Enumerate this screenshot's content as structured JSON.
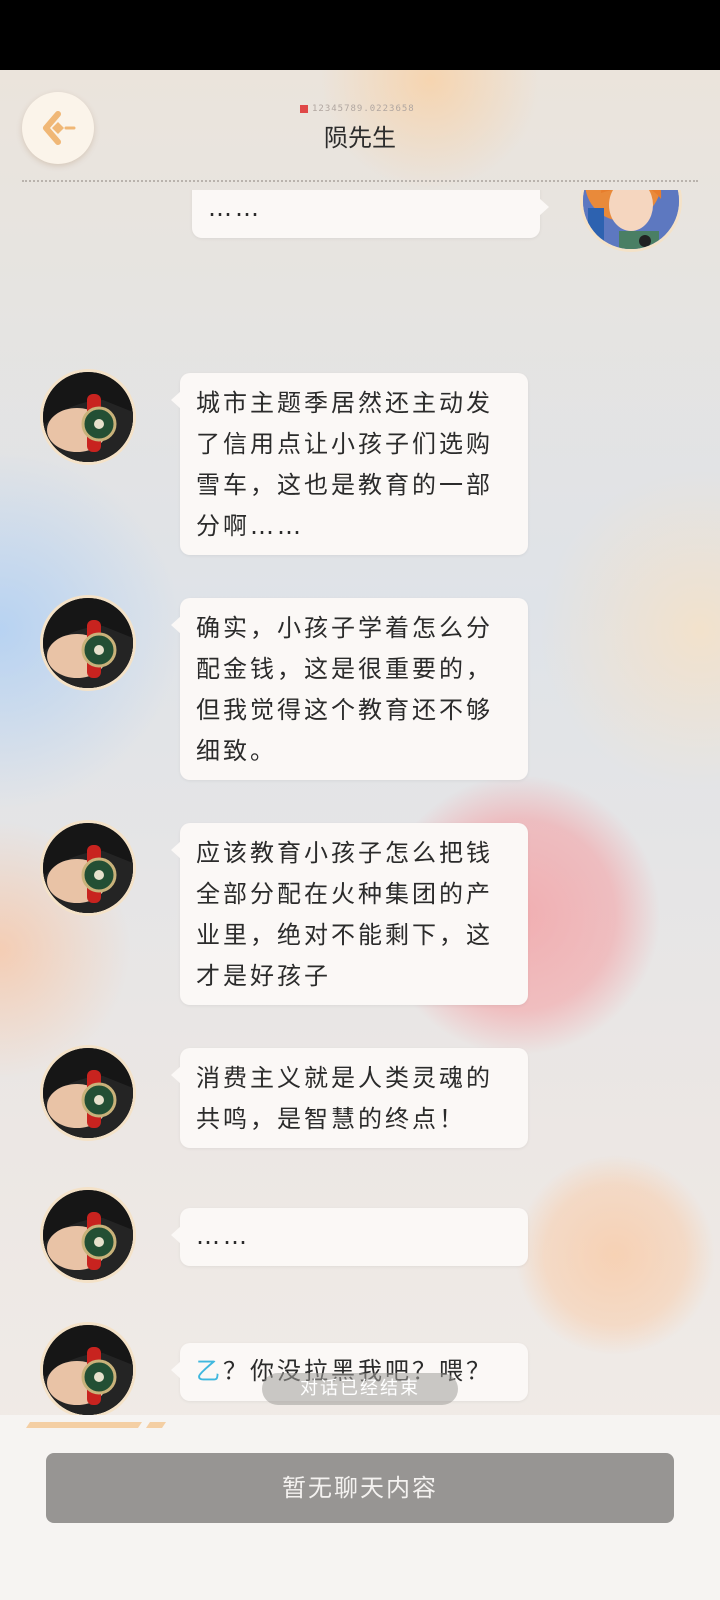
{
  "header": {
    "title": "陨先生",
    "uid": "12345789.0223658"
  },
  "messages": [
    {
      "sender": "self",
      "text": "……"
    },
    {
      "sender": "陨先生",
      "text": "城市主题季居然还主动发了信用点让小孩子们选购雪车，这也是教育的一部分啊……"
    },
    {
      "sender": "陨先生",
      "text": "确实，小孩子学着怎么分配金钱，这是很重要的，但我觉得这个教育还不够细致。"
    },
    {
      "sender": "陨先生",
      "text": "应该教育小孩子怎么把钱全部分配在火种集团的产业里，绝对不能剩下，这才是好孩子"
    },
    {
      "sender": "陨先生",
      "text": "消费主义就是人类灵魂的共鸣，是智慧的终点！"
    },
    {
      "sender": "陨先生",
      "text": "……"
    },
    {
      "sender": "陨先生",
      "prefix": "乙",
      "text": "？你没拉黑我吧？喂？"
    }
  ],
  "status": {
    "conversation_ended": "对话已经结束"
  },
  "footer": {
    "no_content_label": "暂无聊天内容"
  },
  "colors": {
    "accent": "#3fb7de",
    "bubble": "#fbf8f6",
    "footer_button": "#979593"
  }
}
